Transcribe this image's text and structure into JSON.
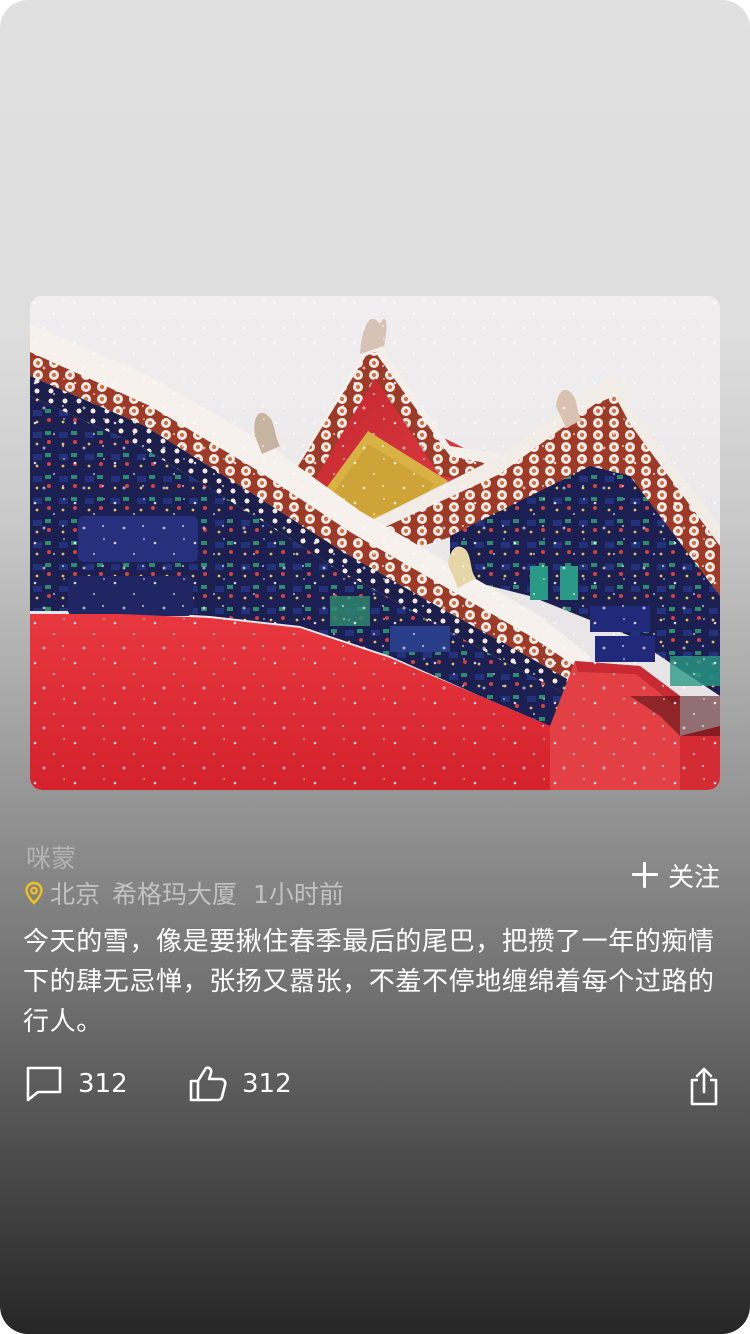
{
  "post": {
    "author": "咪蒙",
    "location_city": "北京",
    "location_place": "希格玛大厦",
    "time": "1小时前",
    "follow_label": "关注",
    "text": "今天的雪，像是要揪住春季最后的尾巴，把攒了一年的痴情下的肆无忌惮，张扬又嚣张，不羞不停地缠绵着每个过路的行人。",
    "comment_count": "312",
    "like_count": "312"
  },
  "icons": {
    "location": "location-pin-icon",
    "follow": "plus-icon",
    "comment": "comment-bubble-icon",
    "like": "thumbs-up-icon",
    "share": "share-icon"
  },
  "colors": {
    "pin": "#f1c21b",
    "text": "#ffffff",
    "muted": "#b4b4b4"
  }
}
